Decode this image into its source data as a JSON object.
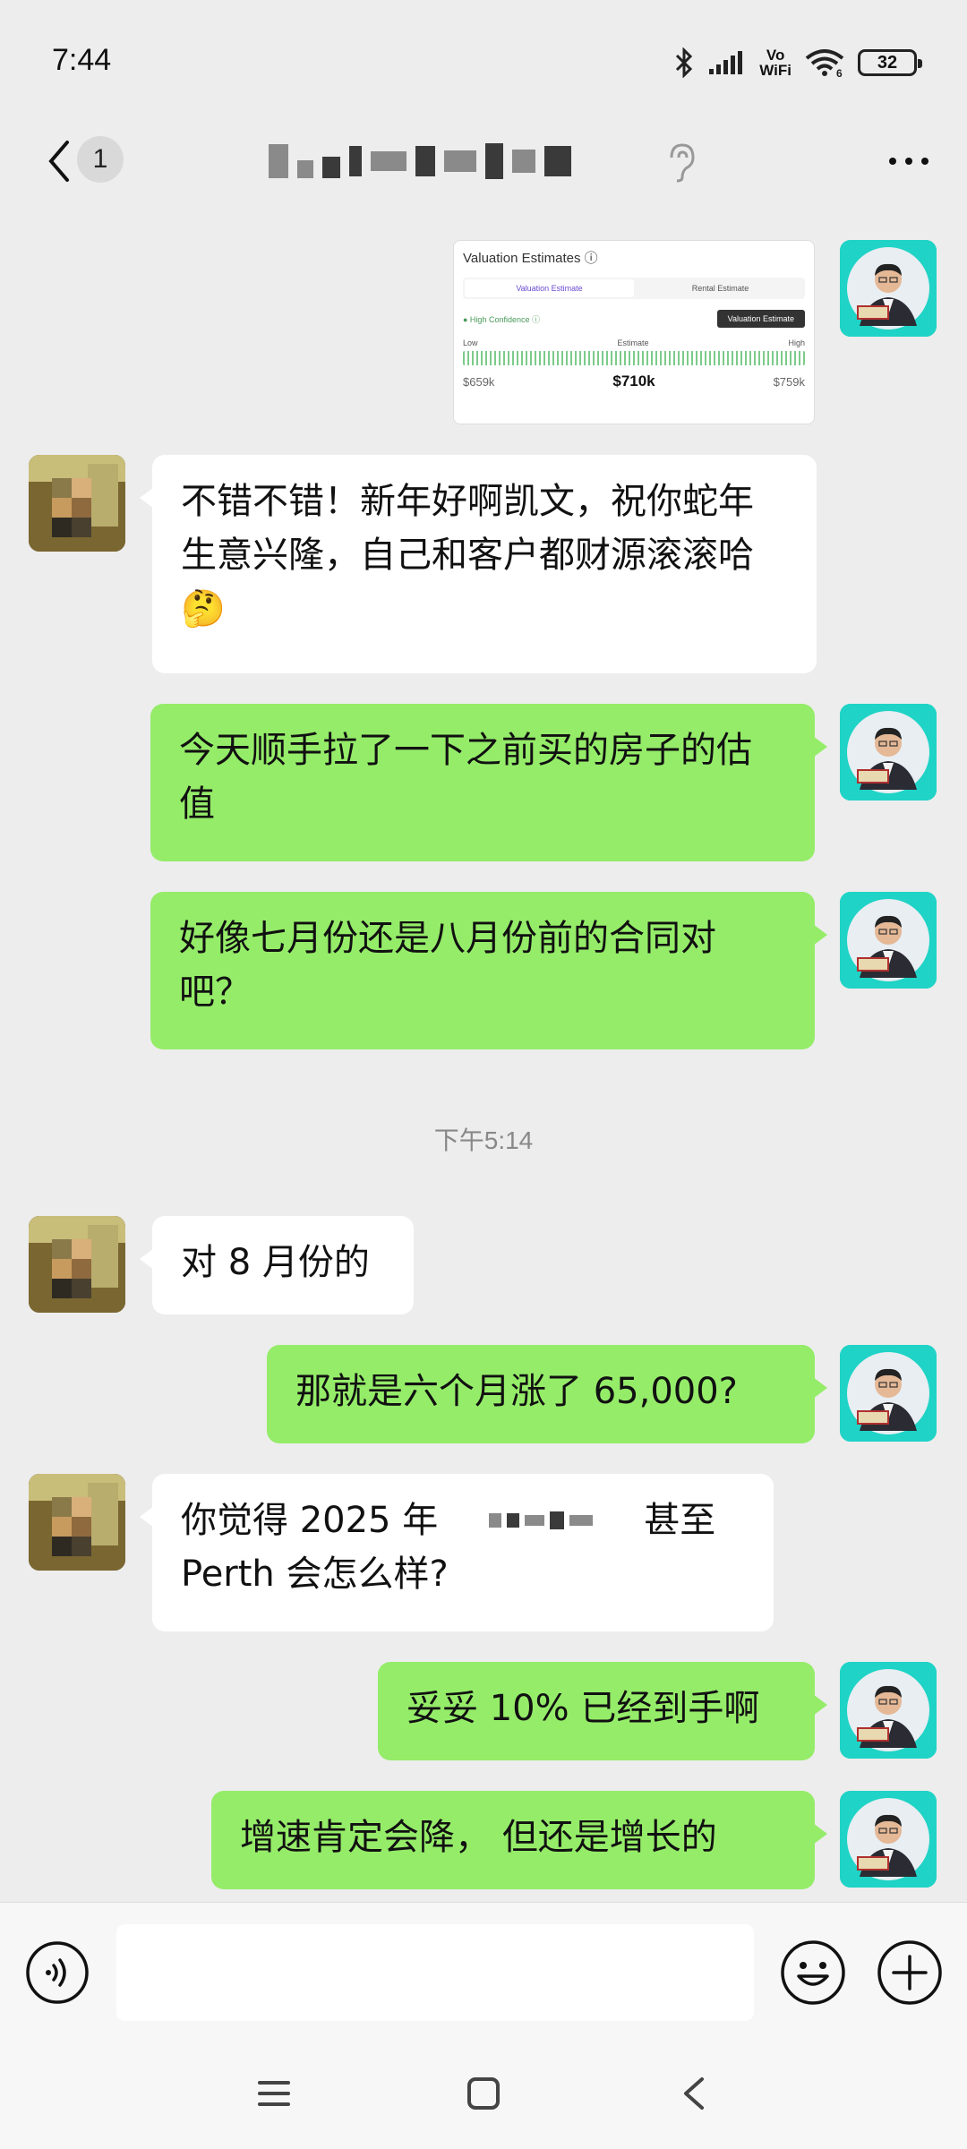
{
  "status_bar": {
    "time": "7:44",
    "network_label_top": "Vo",
    "network_label_bottom": "WiFi",
    "wifi_sub": "6",
    "battery": "32"
  },
  "header": {
    "unread_count": "1"
  },
  "valuation_card": {
    "title": "Valuation Estimates ⓘ",
    "tab_active": "Valuation Estimate",
    "tab_other": "Rental Estimate",
    "confidence": "● High Confidence ⓘ",
    "button": "Valuation Estimate",
    "low_label": "Low",
    "estimate_label": "Estimate",
    "high_label": "High",
    "low_value": "$659k",
    "mid_value": "$710k",
    "high_value": "$759k"
  },
  "messages": [
    {
      "side": "them",
      "text": "不错不错！新年好啊凯文，祝你蛇年生意兴隆，自己和客户都财源滚滚哈🤔"
    },
    {
      "side": "me",
      "text": "今天顺手拉了一下之前买的房子的估值"
    },
    {
      "side": "me",
      "text": "好像七月份还是八月份前的合同对吧？"
    },
    {
      "side": "them",
      "text": "对 8 月份的"
    },
    {
      "side": "me",
      "text": "那就是六个月涨了 65,000?"
    },
    {
      "side": "them",
      "text_before": "你觉得 2025 年",
      "text_after": "甚至",
      "text_line2": "Perth 会怎么样?"
    },
    {
      "side": "me",
      "text": "妥妥 10% 已经到手啊"
    },
    {
      "side": "me",
      "text": "增速肯定会降， 但还是增长的"
    }
  ],
  "timestamp": "下午5:14",
  "icons": {
    "back": "chevron-left-icon",
    "ear": "ear-icon",
    "more": "more-dots-icon",
    "voice": "voice-icon",
    "emoji": "emoji-icon",
    "plus": "plus-icon"
  },
  "colors": {
    "my_bubble": "#95ec69",
    "their_bubble": "#ffffff",
    "background": "#ededed",
    "avatar_bg": "#1fd3c6"
  }
}
